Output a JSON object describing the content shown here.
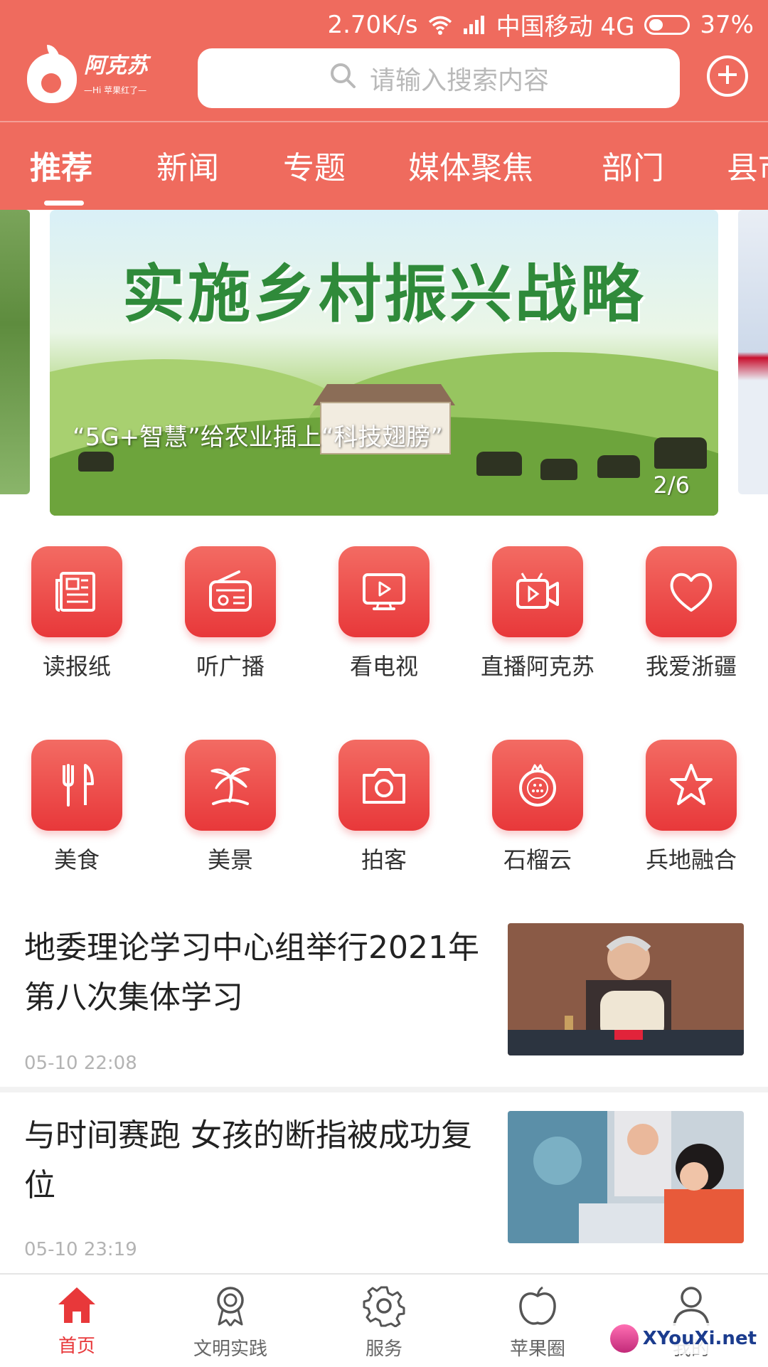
{
  "status_bar": {
    "speed": "2.70K/s",
    "carrier": "中国移动 4G",
    "battery": "37%",
    "battery_level": 0.37
  },
  "header": {
    "logo_text": "阿克苏",
    "logo_subtext": "—Hi 苹果红了—",
    "search_placeholder": "请输入搜索内容"
  },
  "nav": {
    "tabs": [
      "推荐",
      "新闻",
      "专题",
      "媒体聚焦",
      "部门",
      "县市"
    ],
    "active_index": 0
  },
  "banner": {
    "title": "实施乡村振兴战略",
    "caption": "“5G+智慧”给农业插上“科技翅膀”",
    "page_indicator": "2/6"
  },
  "grid": {
    "row1": [
      {
        "label": "读报纸",
        "icon": "newspaper-icon"
      },
      {
        "label": "听广播",
        "icon": "radio-icon"
      },
      {
        "label": "看电视",
        "icon": "tv-icon"
      },
      {
        "label": "直播阿克苏",
        "icon": "video-camera-icon"
      },
      {
        "label": "我爱浙疆",
        "icon": "heart-icon"
      }
    ],
    "row2": [
      {
        "label": "美食",
        "icon": "fork-knife-icon"
      },
      {
        "label": "美景",
        "icon": "palm-tree-icon"
      },
      {
        "label": "拍客",
        "icon": "camera-icon"
      },
      {
        "label": "石榴云",
        "icon": "pomegranate-icon"
      },
      {
        "label": "兵地融合",
        "icon": "star-icon"
      }
    ]
  },
  "articles": [
    {
      "title": "地委理论学习中心组举行2021年第八次集体学习",
      "time": "05-10 22:08"
    },
    {
      "title": "与时间赛跑 女孩的断指被成功复位",
      "time": "05-10 23:19"
    }
  ],
  "tabbar": {
    "items": [
      {
        "label": "首页",
        "icon": "home-icon"
      },
      {
        "label": "文明实践",
        "icon": "medal-icon"
      },
      {
        "label": "服务",
        "icon": "gear-icon"
      },
      {
        "label": "苹果圈",
        "icon": "apple-icon"
      },
      {
        "label": "我的",
        "icon": "user-icon"
      }
    ],
    "active_index": 0
  },
  "watermark": {
    "text": "XYouXi.net"
  },
  "colors": {
    "brand": "#ef6b5e",
    "tile": "#e8383a",
    "active": "#e8383a"
  }
}
